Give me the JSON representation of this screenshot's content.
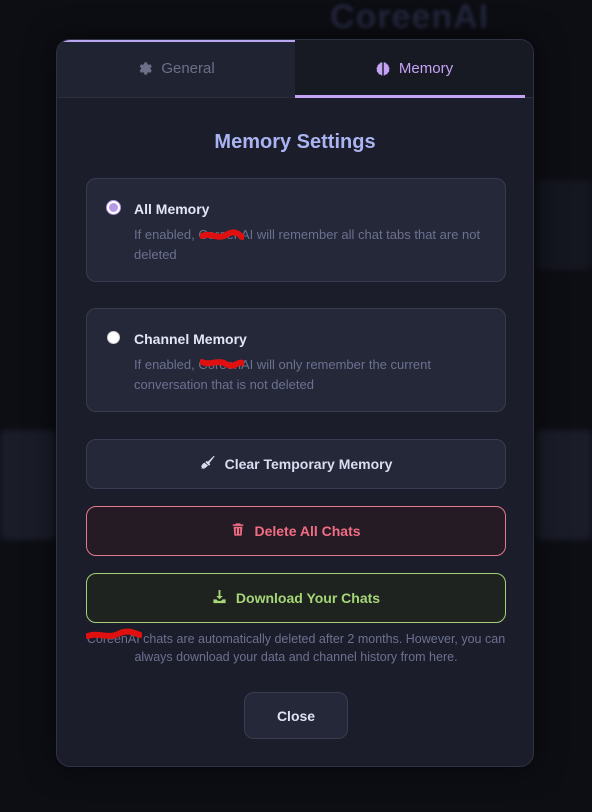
{
  "background": {
    "brand_hint": "CoreenAI"
  },
  "tabs": [
    {
      "label": "General",
      "icon": "gear-icon",
      "active": false
    },
    {
      "label": "Memory",
      "icon": "brain-icon",
      "active": true
    }
  ],
  "title": "Memory Settings",
  "options": [
    {
      "title": "All Memory",
      "description": "If enabled, CoreenAI will remember all chat tabs that are not deleted",
      "selected": true
    },
    {
      "title": "Channel Memory",
      "description": "If enabled, CoreenAI will only remember the current conversation that is not deleted",
      "selected": false
    }
  ],
  "actions": {
    "clear": "Clear Temporary Memory",
    "delete": "Delete All Chats",
    "download": "Download Your Chats"
  },
  "note": "CoreenAI chats are automatically deleted after 2 months. However, you can always download your data and channel history from here.",
  "close_label": "Close",
  "colors": {
    "accent": "#c4a3f5",
    "title": "#aab4f2",
    "danger": "#f26d84",
    "success": "#a6d677"
  }
}
